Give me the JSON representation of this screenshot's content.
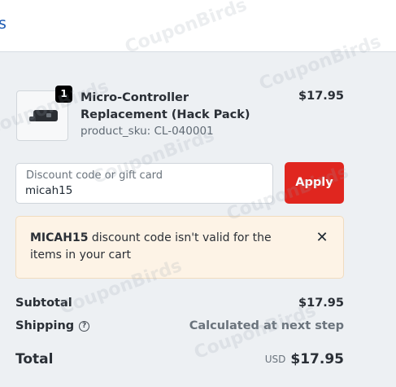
{
  "header": {
    "breadcrumb_fragment": "s"
  },
  "product": {
    "image_icon": "micro-controller-device",
    "quantity": "1",
    "name": "Micro-Controller Replacement (Hack Pack)",
    "sku": "product_sku: CL-040001",
    "price": "$17.95"
  },
  "discount": {
    "label": "Discount code or gift card",
    "value": "micah15",
    "apply_label": "Apply",
    "apply_color": "#e0261f"
  },
  "error": {
    "code": "MICAH15",
    "message": " discount code isn't valid for the items in your cart",
    "close_icon": "close-icon",
    "background": "#fdf3e6"
  },
  "summary": {
    "subtotal_label": "Subtotal",
    "subtotal_value": "$17.95",
    "shipping_label": "Shipping",
    "shipping_help_icon": "question-circle-icon",
    "shipping_value": "Calculated at next step",
    "total_label": "Total",
    "total_currency": "USD",
    "total_value": "$17.95"
  },
  "watermark_text": "CouponBirds"
}
